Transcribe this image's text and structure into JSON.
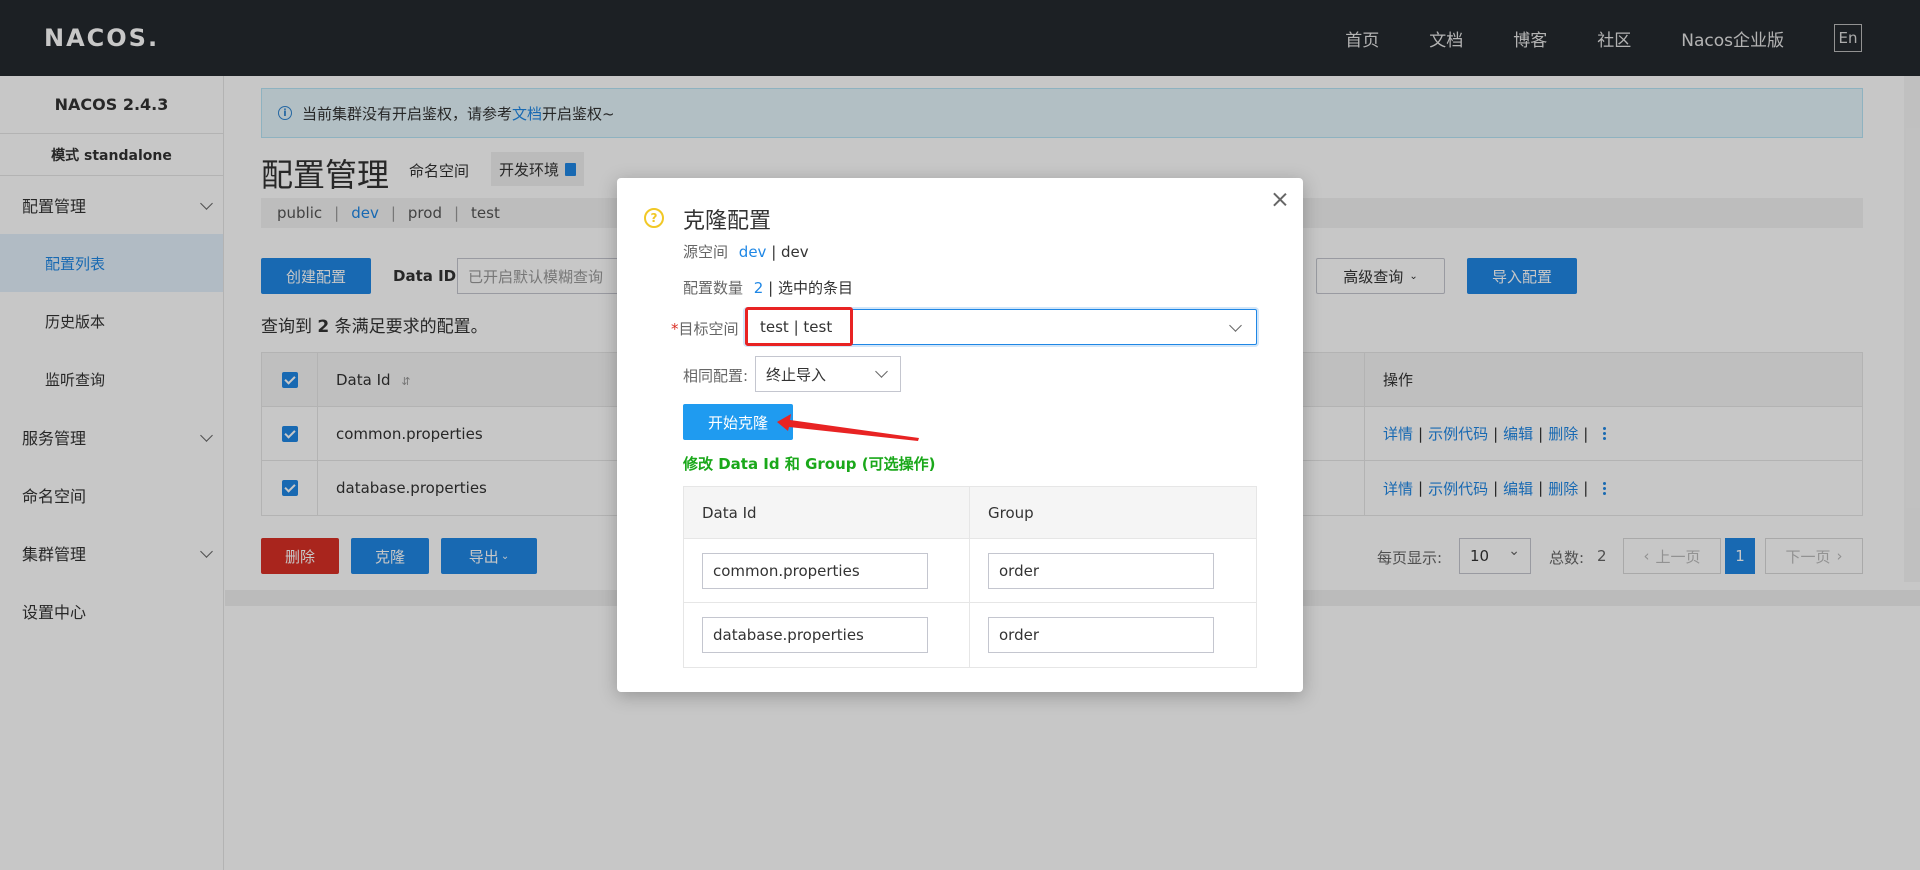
{
  "topbar": {
    "logo": "NACOS.",
    "nav": [
      "首页",
      "文档",
      "博客",
      "社区",
      "Nacos企业版"
    ],
    "lang": "En"
  },
  "sidebar": {
    "version": "NACOS 2.4.3",
    "mode": "模式 standalone",
    "items": [
      {
        "label": "配置管理",
        "sub": [
          "配置列表",
          "历史版本",
          "监听查询"
        ]
      },
      {
        "label": "服务管理"
      },
      {
        "label": "命名空间"
      },
      {
        "label": "集群管理"
      },
      {
        "label": "设置中心"
      }
    ]
  },
  "notice": {
    "before": "当前集群没有开启鉴权，请参考",
    "link": "文档",
    "after": "开启鉴权~"
  },
  "page": {
    "title": "配置管理",
    "namespace_label": "命名空间",
    "namespace_current": "开发环境",
    "namespaces": [
      "public",
      "dev",
      "prod",
      "test"
    ],
    "active_namespace": "dev"
  },
  "toolbar": {
    "create": "创建配置",
    "dataid_label": "Data ID",
    "dataid_placeholder": "已开启默认模糊查询",
    "advanced": "高级查询",
    "import": "导入配置"
  },
  "result": {
    "prefix": "查询到",
    "count": "2",
    "suffix": "条满足要求的配置。"
  },
  "table": {
    "headers": {
      "data_id": "Data Id",
      "ops": "操作"
    },
    "rows": [
      {
        "data_id": "common.properties"
      },
      {
        "data_id": "database.properties"
      }
    ],
    "actions": [
      "详情",
      "示例代码",
      "编辑",
      "删除"
    ]
  },
  "bottom": {
    "delete": "删除",
    "clone": "克隆",
    "export": "导出"
  },
  "pager": {
    "per_page_label": "每页显示:",
    "per_page": "10",
    "total_label": "总数:",
    "total": "2",
    "prev": "上一页",
    "next": "下一页",
    "current": "1"
  },
  "dialog": {
    "title": "克隆配置",
    "source_label": "源空间",
    "source_ns": "dev",
    "source_name": "| dev",
    "count_label": "配置数量",
    "count": "2",
    "count_suffix": "| 选中的条目",
    "target_label": "目标空间",
    "target_value": "test | test",
    "same_label": "相同配置:",
    "same_value": "终止导入",
    "start": "开始克隆",
    "modify_hint": "修改 Data Id 和 Group (可选操作)",
    "table_headers": {
      "data_id": "Data Id",
      "group": "Group"
    },
    "rows": [
      {
        "data_id": "common.properties",
        "group": "order"
      },
      {
        "data_id": "database.properties",
        "group": "order"
      }
    ]
  },
  "colors": {
    "primary": "#1f87e5",
    "danger": "#d93026",
    "highlight": "#e82323",
    "success": "#1aa81a"
  }
}
